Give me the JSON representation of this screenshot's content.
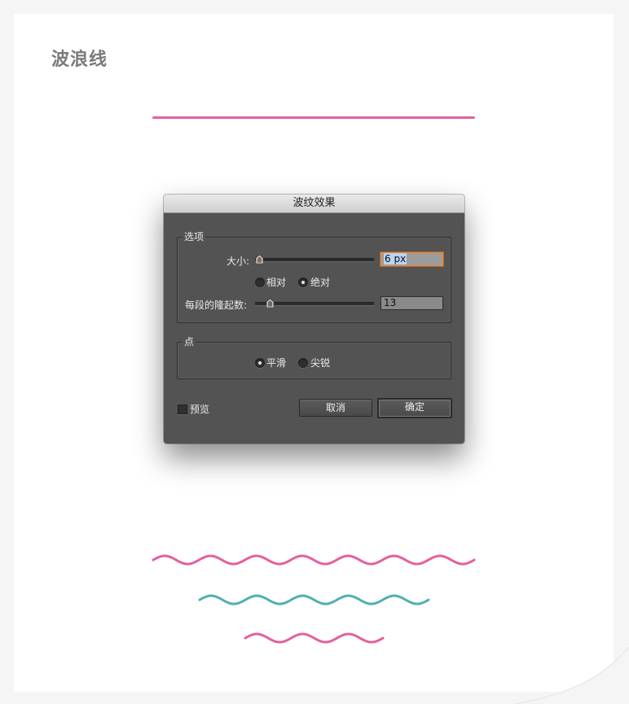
{
  "page": {
    "heading": "波浪线",
    "colors": {
      "pink": "#e45fa0",
      "teal": "#4fb1ad"
    }
  },
  "dialog": {
    "title": "波纹效果",
    "options_group": {
      "label": "选项",
      "size_label": "大小:",
      "size_value": "6 px",
      "size_slider_fraction": 0.04,
      "relative_label": "相对",
      "absolute_label": "绝对",
      "mode_selected": "absolute",
      "ridges_label": "每段的隆起数:",
      "ridges_value": "13",
      "ridges_slider_fraction": 0.13
    },
    "points_group": {
      "label": "点",
      "smooth_label": "平滑",
      "corner_label": "尖锐",
      "selected": "smooth"
    },
    "preview_label": "预览",
    "preview_checked": false,
    "cancel_label": "取消",
    "ok_label": "确定"
  }
}
